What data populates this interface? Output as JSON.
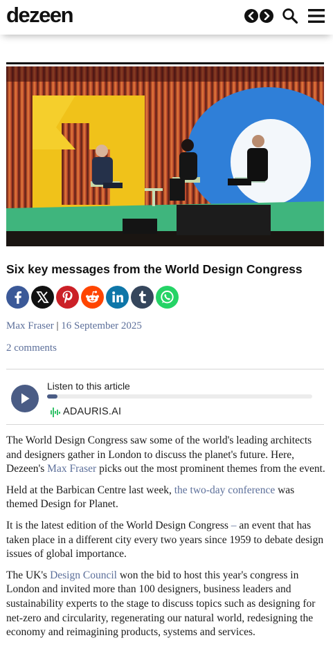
{
  "header": {
    "logo": "dezeen",
    "icons": [
      "prev-icon",
      "next-icon",
      "search-icon",
      "menu-icon"
    ]
  },
  "article": {
    "headline": "Six key messages from the World Design Congress",
    "share_icons": [
      "facebook-icon",
      "x-icon",
      "pinterest-icon",
      "reddit-icon",
      "linkedin-icon",
      "tumblr-icon",
      "whatsapp-icon"
    ],
    "author": "Max Fraser",
    "separator": "|",
    "date": "16 September 2025",
    "comments": "2 comments"
  },
  "audio": {
    "label": "Listen to this article",
    "progress": 0.04,
    "brand": "ADAURIS.AI"
  },
  "body": {
    "p1_a": "The World Design Congress saw some of the world's leading architects and designers gather in London to discuss the planet's future. Here, Dezeen's ",
    "p1_link": "Max Fraser",
    "p1_b": " picks out the most prominent themes from the event.",
    "p2_a": "Held at the Barbican Centre last week, ",
    "p2_link": "the two-day conference",
    "p2_b": " was themed Design for Planet.",
    "p3_a": "It is the latest edition of the World Design Congress ",
    "p3_dash": "–",
    "p3_b": " an event that has taken place in a different city every two years since 1959 to debate design issues of global importance.",
    "p4_a": "The UK's ",
    "p4_link": "Design Council",
    "p4_b": " won the bid to host this year's congress in London and invited more than 100 designers, business leaders and sustainability experts to the stage to discuss topics such as designing for net-zero and circularity, regenerating our natural world, redesigning the economy and reimagining products, systems and services."
  },
  "colors": {
    "link": "#5c6f9a",
    "player": "#4a5c85",
    "facebook": "#3b5998",
    "x": "#111111",
    "pinterest": "#cb2027",
    "reddit": "#ff4500",
    "linkedin": "#0e76a8",
    "tumblr": "#35465c",
    "whatsapp": "#25d366"
  }
}
